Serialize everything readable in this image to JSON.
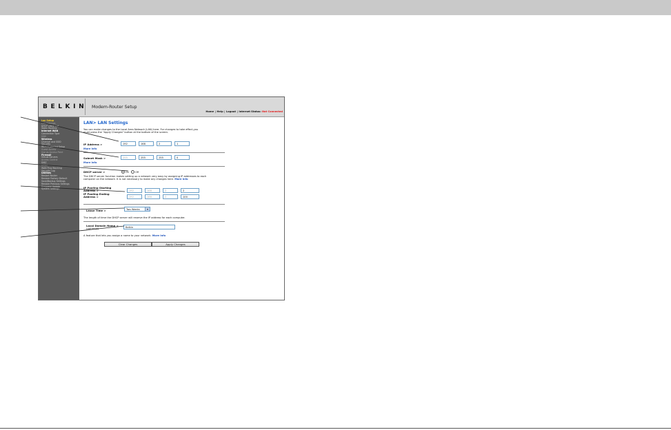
{
  "router": {
    "brand": "BELKIN",
    "product": "Modem-Router Setup",
    "links": [
      "Home",
      "Help",
      "Logout"
    ],
    "status_label": "Internet Status:",
    "status_value": "Not Connected"
  },
  "sidebar": {
    "items": [
      {
        "label": "Lan Setup",
        "kind": "active"
      },
      {
        "label": "LAN Settings",
        "kind": "dim"
      },
      {
        "label": "DHCP client List",
        "kind": "normal"
      },
      {
        "label": "Static Routing",
        "kind": "normal"
      },
      {
        "label": "Internet WAN",
        "kind": "head"
      },
      {
        "label": "Connection Type",
        "kind": "normal"
      },
      {
        "label": "DNS",
        "kind": "dim"
      },
      {
        "label": "Wireless",
        "kind": "head"
      },
      {
        "label": "Channel and SSID",
        "kind": "normal"
      },
      {
        "label": "Security",
        "kind": "normal"
      },
      {
        "label": "Wi-Fi Protected Setup",
        "kind": "normal"
      },
      {
        "label": "Guest Access",
        "kind": "dim"
      },
      {
        "label": "Use as Access Point",
        "kind": "dim"
      },
      {
        "label": "Firewall",
        "kind": "head"
      },
      {
        "label": "Virtual Servers",
        "kind": "normal"
      },
      {
        "label": "Access Control",
        "kind": "dim"
      },
      {
        "label": "DMZ",
        "kind": "normal"
      },
      {
        "label": "DDNS",
        "kind": "dim"
      },
      {
        "label": "WAN Ping Blocking",
        "kind": "normal"
      },
      {
        "label": "Security Log",
        "kind": "normal"
      },
      {
        "label": "Utilities",
        "kind": "head"
      },
      {
        "label": "Restart Router",
        "kind": "normal"
      },
      {
        "label": "Restore Factory Default",
        "kind": "normal"
      },
      {
        "label": "Save/Backup Settings",
        "kind": "normal"
      },
      {
        "label": "Restore Previous Settings",
        "kind": "normal"
      },
      {
        "label": "Firmware Update",
        "kind": "normal"
      },
      {
        "label": "System Settings",
        "kind": "normal"
      }
    ]
  },
  "page": {
    "title": "LAN> LAN Settings",
    "intro_1": "You can make changes to the Local Area Network (LAN) here. For changes to take effect,you",
    "intro_2": "must press the \"Apply Changes\" button at the bottom of the screen.",
    "ip_label": "IP Address >",
    "ip": [
      "192",
      "168",
      "2",
      "1"
    ],
    "more_info": "More Info",
    "mask_label": "Subnet Mask >",
    "mask": [
      "255",
      "255",
      "255",
      "0"
    ],
    "dhcp_label": "DHCP server >",
    "dhcp_on": "On",
    "dhcp_off": "Off",
    "dhcp_desc_1": "The DHCP server function makes setting up a network very easy by assigning IP addresses to each",
    "dhcp_desc_2": "computer on the network. It is not necessary to make any changes here.",
    "pool_start_label_1": "IP Pooling Starting",
    "pool_start_label_2": "Address >",
    "pool_start": [
      "192",
      "168",
      "2",
      "2"
    ],
    "pool_end_label_1": "IP Pooling Ending",
    "pool_end_label_2": "Address >",
    "pool_end": [
      "192",
      "168",
      "2",
      "100"
    ],
    "lease_label": "Lease Time >",
    "lease_value": "Two Weeks",
    "lease_desc": "The length of time the DHCP server will reserve the IP address for each computer.",
    "domain_label_1": "Local Domain Name >",
    "domain_label_2": "(optional)",
    "domain_value": "Belkin",
    "domain_desc": "A feature that lets you assign a name to your network.",
    "clear_button": "Clear Changes",
    "apply_button": "Apply Changes"
  }
}
